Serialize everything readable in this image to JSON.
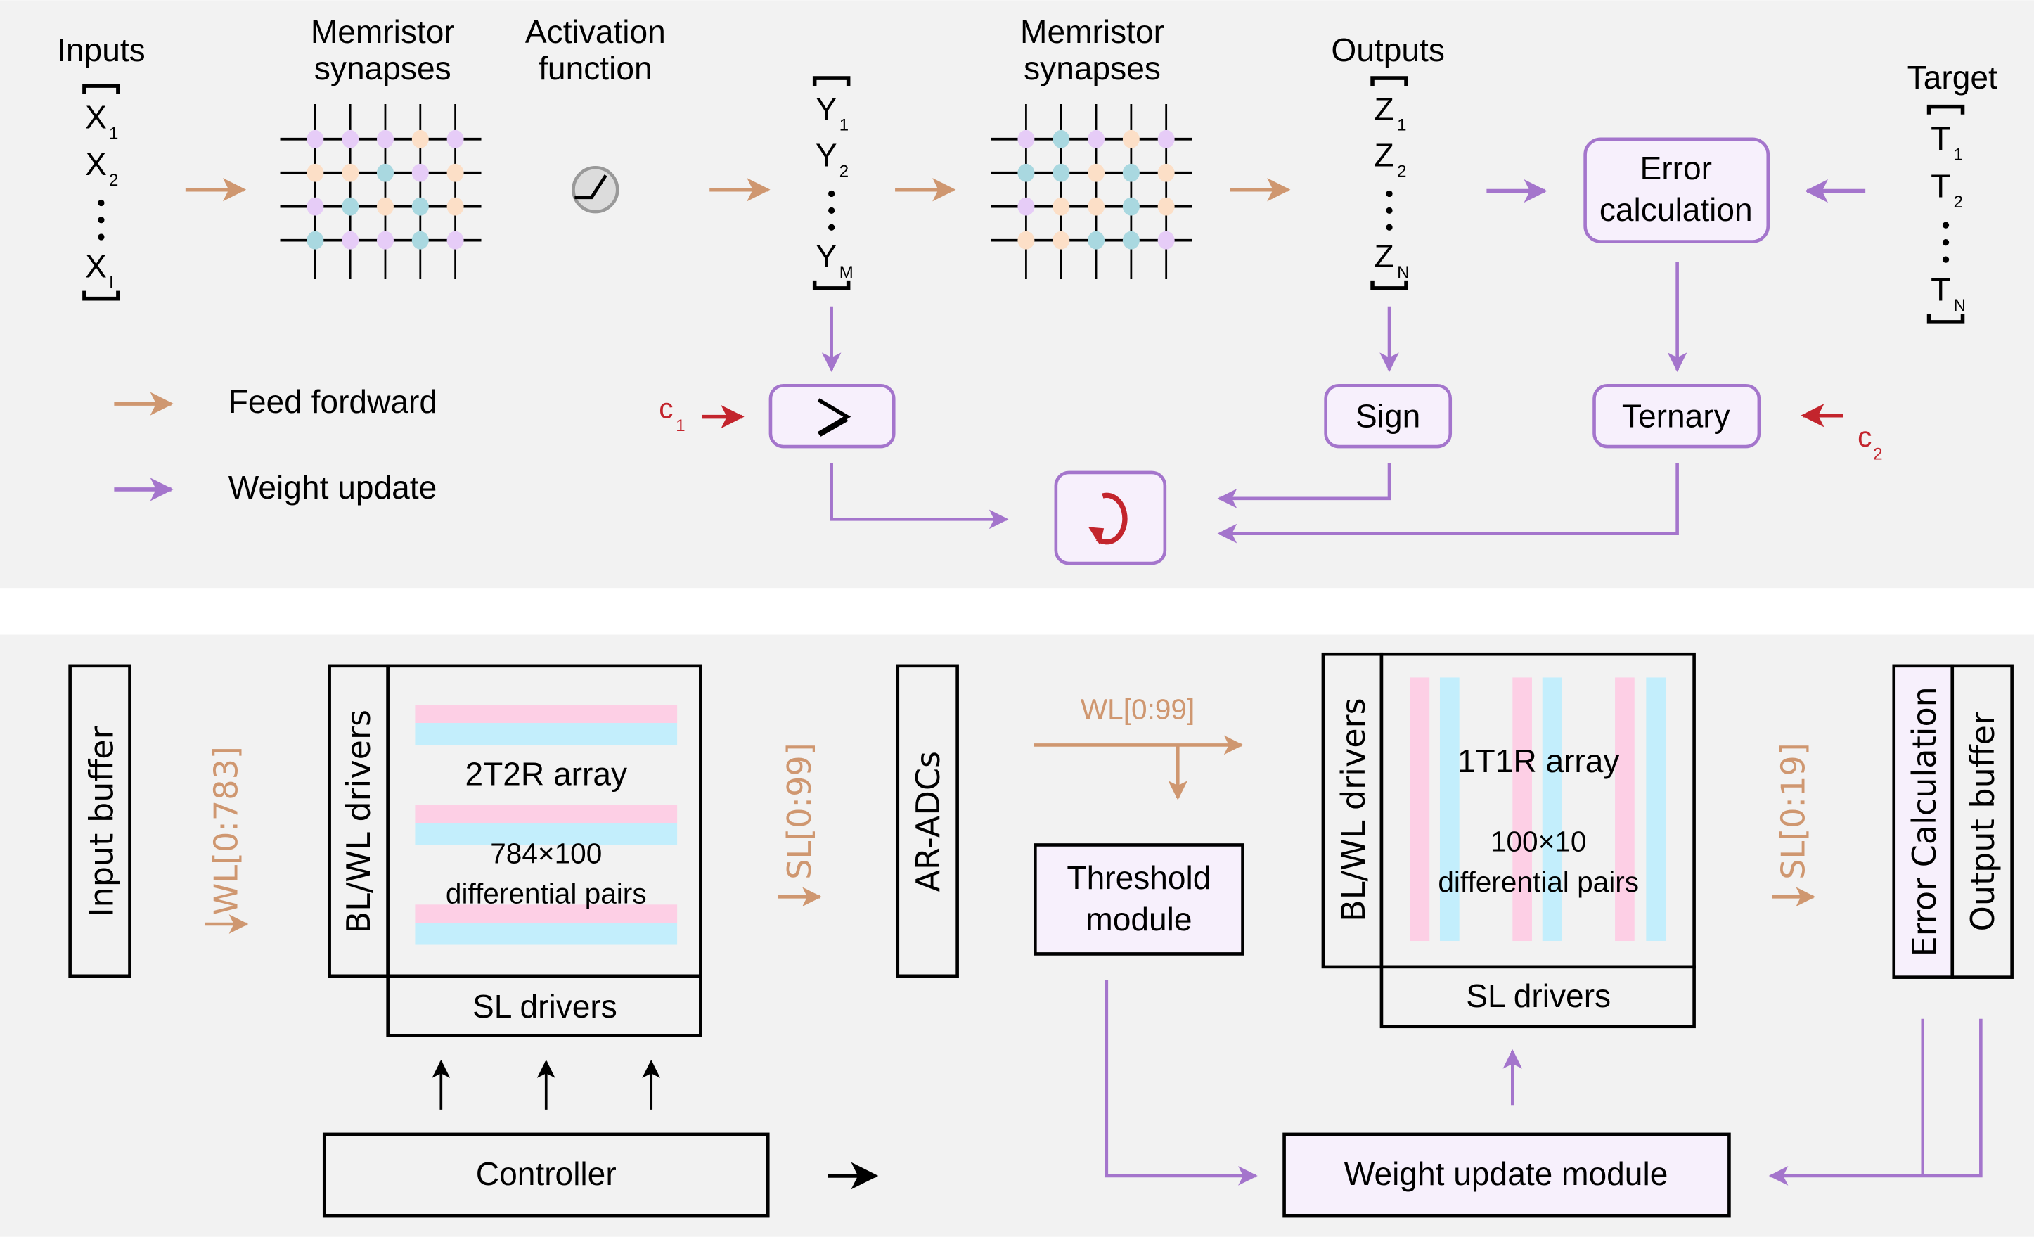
{
  "top_panel": {
    "headers": {
      "inputs": "Inputs",
      "memristor_synapses_1": [
        "Memristor",
        "synapses"
      ],
      "activation_function": [
        "Activation",
        "function"
      ],
      "memristor_synapses_2": [
        "Memristor",
        "synapses"
      ],
      "outputs": "Outputs",
      "target": "Target"
    },
    "vectors": {
      "x": {
        "base": "X",
        "subs": [
          "1",
          "2",
          "I"
        ]
      },
      "y": {
        "base": "Y",
        "subs": [
          "1",
          "2",
          "M"
        ]
      },
      "z": {
        "base": "Z",
        "subs": [
          "1",
          "2",
          "N"
        ]
      },
      "t": {
        "base": "T",
        "subs": [
          "1",
          "2",
          "N"
        ]
      }
    },
    "synapse_grid_1": [
      [
        "p",
        "p",
        "p",
        "o",
        "p"
      ],
      [
        "o",
        "o",
        "b",
        "p",
        "o"
      ],
      [
        "p",
        "b",
        "o",
        "b",
        "o"
      ],
      [
        "b",
        "p",
        "p",
        "b",
        "p"
      ]
    ],
    "synapse_grid_2": [
      [
        "p",
        "b",
        "p",
        "o",
        "p"
      ],
      [
        "b",
        "b",
        "o",
        "b",
        "o"
      ],
      [
        "p",
        "o",
        "o",
        "b",
        "o"
      ],
      [
        "o",
        "o",
        "b",
        "b",
        "p"
      ]
    ],
    "dot_colors": {
      "p": "#E6CCF7",
      "o": "#FCDFC7",
      "b": "#A9D8E0"
    },
    "boxes": {
      "error_calculation": [
        "Error",
        "calculation"
      ],
      "comparator": "⩾",
      "sign": "Sign",
      "ternary": "Ternary"
    },
    "constants": {
      "c1": {
        "base": "c",
        "sub": "1"
      },
      "c2": {
        "base": "c",
        "sub": "2"
      }
    },
    "legend": [
      {
        "label": "Feed fordward",
        "color": "#CF9770"
      },
      {
        "label": "Weight update",
        "color": "#A475CC"
      }
    ]
  },
  "bottom_panel": {
    "input_buffer": "Input buffer",
    "wl_783": "WL[0:783]",
    "array1": {
      "driver_label": "BL/WL drivers",
      "title": "2T2R array",
      "size": "784×100",
      "desc": "differential pairs",
      "sl_drivers": "SL drivers"
    },
    "sl_99": "SL[0:99]",
    "ar_adcs": "AR-ADCs",
    "wl_99": "WL[0:99]",
    "threshold_module": [
      "Threshold",
      "module"
    ],
    "array2": {
      "driver_label": "BL/WL drivers",
      "title": "1T1R array",
      "size": "100×10",
      "desc": "differential pairs",
      "sl_drivers": "SL drivers"
    },
    "sl_19": "SL[0:19]",
    "error_calculation": "Error Calculation",
    "output_buffer": "Output buffer",
    "controller": "Controller",
    "weight_update_module": "Weight update module"
  },
  "colors": {
    "panel_bg": "#F2F2F2",
    "feed_forward": "#CF9770",
    "weight_update": "#A475CC",
    "constant_red": "#C3252D",
    "box_fill": "#F7F0FC",
    "pink": "#FDCFE5",
    "cyan": "#C3EEFC"
  }
}
